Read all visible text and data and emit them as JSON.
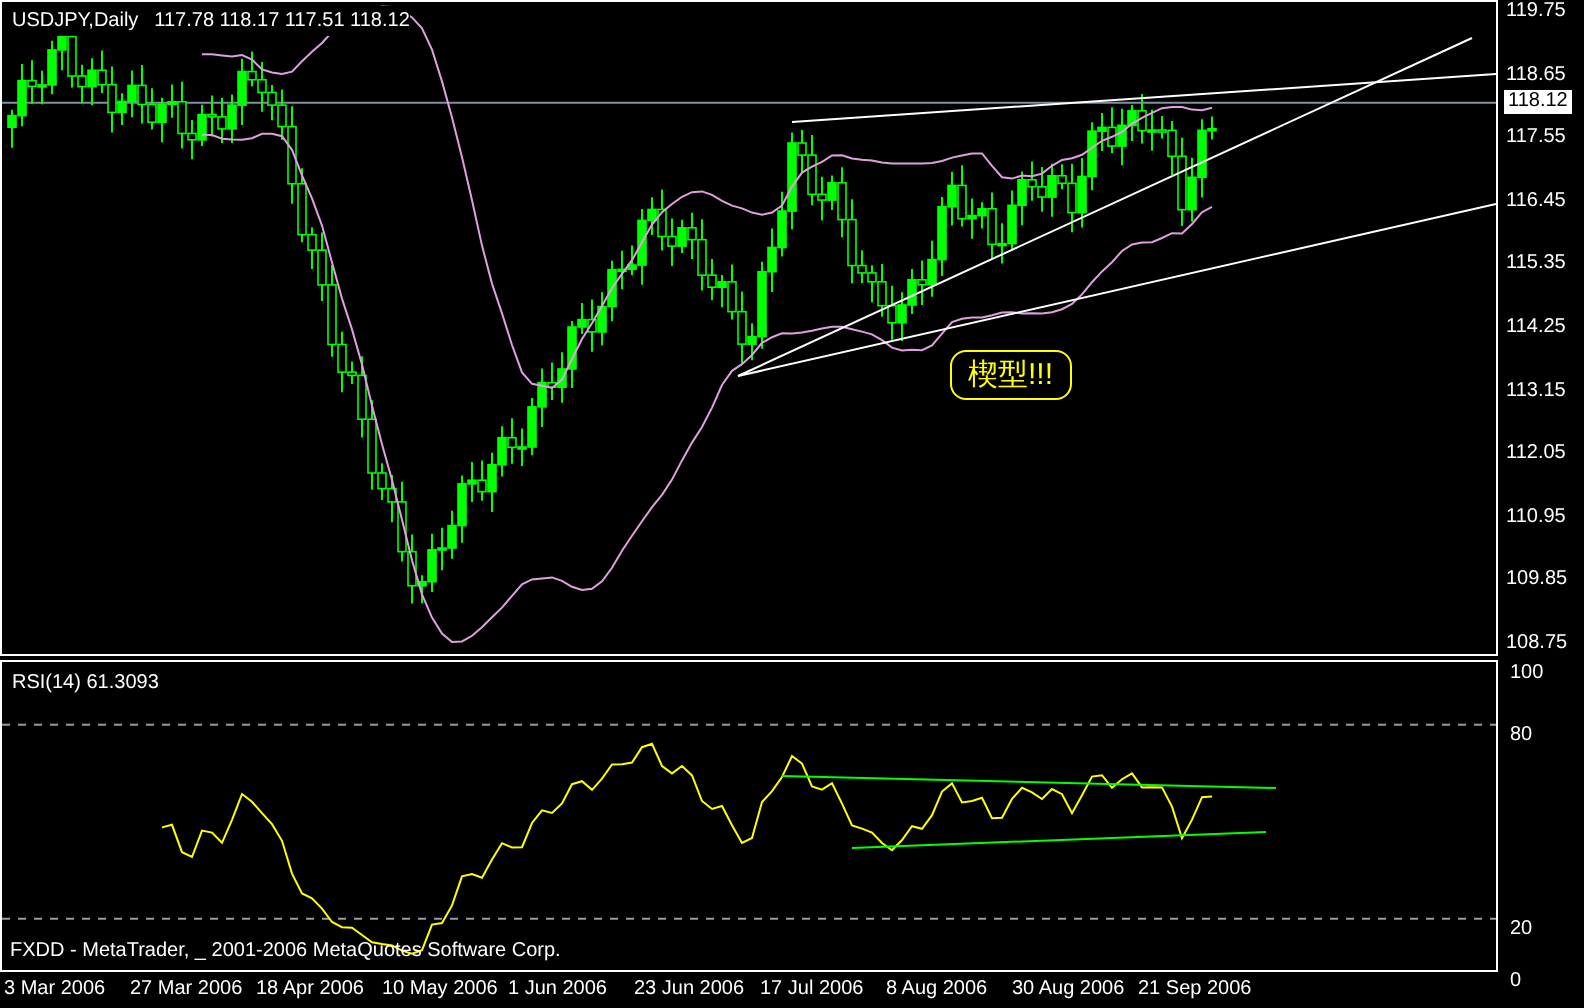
{
  "header": {
    "symbol": "USDJPY,Daily",
    "ohlc": "117.78 118.17 117.51 118.12"
  },
  "price_axis": [
    "119.75",
    "118.65",
    "117.55",
    "116.45",
    "115.35",
    "114.25",
    "113.15",
    "112.05",
    "110.95",
    "109.85",
    "108.75"
  ],
  "current_price": "118.12",
  "annotation": "楔型!!!",
  "rsi": {
    "label": "RSI(14) 61.3093",
    "axis": [
      "100",
      "80",
      "20",
      "0"
    ]
  },
  "copyright": "FXDD - MetaTrader, _ 2001-2006 MetaQuotes Software Corp.",
  "dates": [
    "3 Mar 2006",
    "27 Mar 2006",
    "18 Apr 2006",
    "10 May 2006",
    "1 Jun 2006",
    "23 Jun 2006",
    "17 Jul 2006",
    "8 Aug 2006",
    "30 Aug 2006",
    "21 Sep 2006"
  ]
}
